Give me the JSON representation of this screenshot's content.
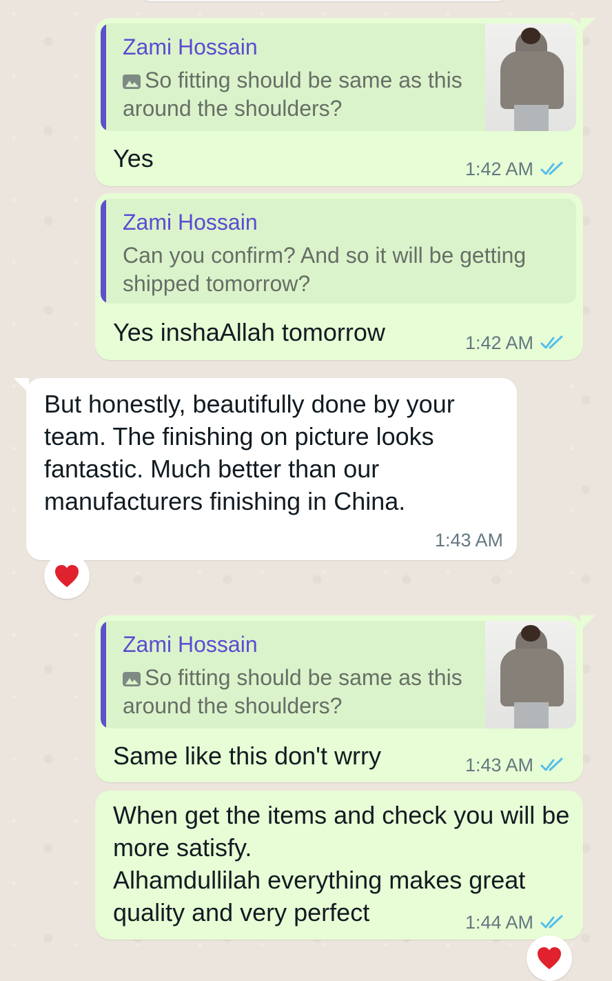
{
  "messages": [
    {
      "direction": "outgoing",
      "quote": {
        "author": "Zami Hossain",
        "text": "So fitting should be same as this around the shoulders?",
        "has_photo": true
      },
      "text": "Yes",
      "time": "1:42 AM",
      "status": "read"
    },
    {
      "direction": "outgoing",
      "quote": {
        "author": "Zami Hossain",
        "text": "Can you confirm? And so it will be getting shipped tomorrow?",
        "has_photo": false
      },
      "text": "Yes inshaAllah tomorrow",
      "time": "1:42 AM",
      "status": "read"
    },
    {
      "direction": "incoming",
      "text": "But honestly, beautifully done by your team. The finishing on picture looks fantastic. Much better than our manufacturers finishing in China.",
      "time": "1:43 AM",
      "reaction": "❤️"
    },
    {
      "direction": "outgoing",
      "quote": {
        "author": "Zami Hossain",
        "text": "So fitting should be same as this around the shoulders?",
        "has_photo": true
      },
      "text": "Same like this don't wrry",
      "time": "1:43 AM",
      "status": "read"
    },
    {
      "direction": "outgoing",
      "text": "When get the items and check you will be more satisfy.\nAlhamdullilah everything makes great quality and very perfect",
      "time": "1:44 AM",
      "status": "read",
      "reaction": "❤️"
    }
  ],
  "colors": {
    "chat_background": "#ece5dd",
    "outgoing_bubble": "#e7fdd5",
    "incoming_bubble": "#ffffff",
    "quote_bar": "#5d51c9",
    "quote_author": "#5a4bd1",
    "read_ticks": "#53bdeb",
    "heart": "#e0212e"
  },
  "icons": {
    "read_receipt": "double-check-icon",
    "photo_attachment": "photo-icon",
    "reaction": "red-heart-emoji"
  }
}
